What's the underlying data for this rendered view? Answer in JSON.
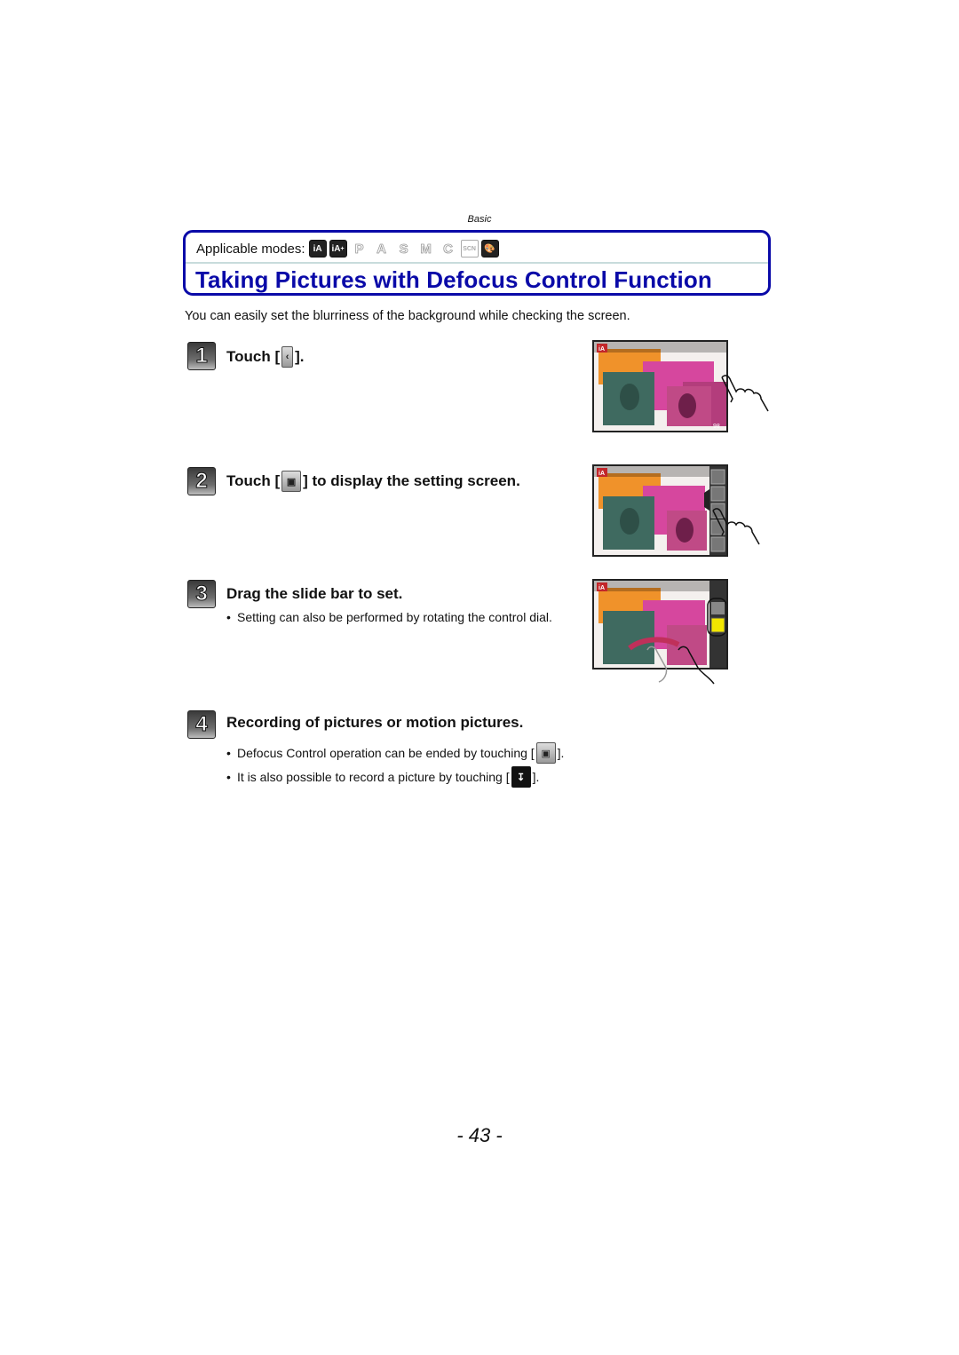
{
  "header": {
    "section": "Basic"
  },
  "title_box": {
    "applicable_label": "Applicable modes:",
    "modes": [
      {
        "name": "iA",
        "icon": "intelligent-auto-icon",
        "enabled": true
      },
      {
        "name": "iA+",
        "icon": "intelligent-auto-plus-icon",
        "enabled": true
      },
      {
        "name": "P",
        "icon": "program-mode-icon",
        "enabled": false
      },
      {
        "name": "A",
        "icon": "aperture-priority-icon",
        "enabled": false
      },
      {
        "name": "S",
        "icon": "shutter-priority-icon",
        "enabled": false
      },
      {
        "name": "M",
        "icon": "manual-mode-icon",
        "enabled": false
      },
      {
        "name": "C",
        "icon": "custom-mode-icon",
        "enabled": false
      },
      {
        "name": "SCN",
        "icon": "scene-mode-icon",
        "enabled": false
      },
      {
        "name": "Creative",
        "icon": "creative-control-icon",
        "enabled": true
      }
    ],
    "title": "Taking Pictures with Defocus Control Function"
  },
  "intro": "You can easily set the blurriness of the background while checking the screen.",
  "steps": [
    {
      "number": "1",
      "pre": "Touch [",
      "icon": "tab-open-icon",
      "post": "]."
    },
    {
      "number": "2",
      "pre": "Touch [",
      "icon": "defocus-control-icon",
      "post": "] to display the setting screen."
    },
    {
      "number": "3",
      "title": "Drag the slide bar to set.",
      "bullets": [
        "Setting can also be performed by rotating the control dial."
      ]
    },
    {
      "number": "4",
      "title": "Recording of pictures or motion pictures.",
      "bullets": [
        {
          "pre": "Defocus Control operation can be ended by touching [",
          "icon": "defocus-exit-icon",
          "post": "]."
        },
        {
          "pre": "It is also possible to record a picture by touching [",
          "icon": "shutter-record-icon",
          "post": "]."
        }
      ]
    }
  ],
  "screens": {
    "mode_badge": "iA",
    "bottom_right": "98"
  },
  "page_number": "- 43 -",
  "colors": {
    "accent": "#0a0aa8",
    "divider": "#c8dcdc",
    "highlight": "#f2e600"
  }
}
